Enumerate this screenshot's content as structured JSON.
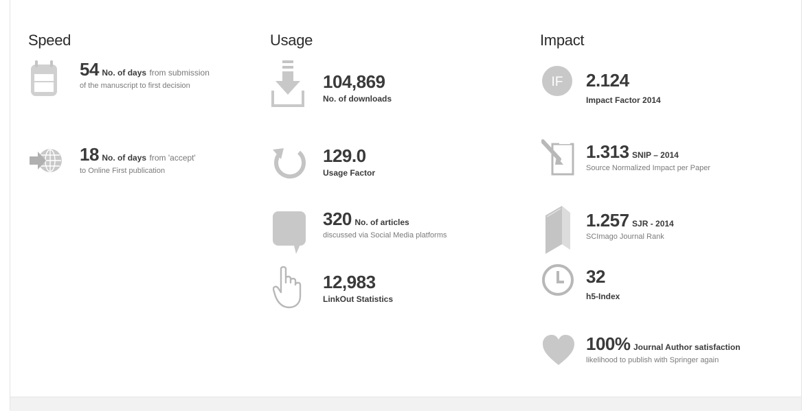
{
  "columns": {
    "speed": {
      "title": "Speed",
      "metrics": [
        {
          "icon": "calendar-icon",
          "value": "54",
          "label": "No. of days",
          "label_rest": "from submission",
          "line2": "of the manuscript to first decision"
        },
        {
          "icon": "globe-arrow-icon",
          "value": "18",
          "label": "No. of days",
          "label_rest": "from 'accept'",
          "line2": "to Online First publication"
        }
      ]
    },
    "usage": {
      "title": "Usage",
      "metrics": [
        {
          "icon": "download-icon",
          "value": "104,869",
          "line2": "No. of downloads"
        },
        {
          "icon": "refresh-icon",
          "value": "129.0",
          "line2": "Usage Factor"
        },
        {
          "icon": "speech-bubble-icon",
          "value": "320",
          "label": "No. of articles",
          "line2": "discussed via Social Media platforms"
        },
        {
          "icon": "pointer-hand-icon",
          "value": "12,983",
          "line2": "LinkOut Statistics"
        }
      ]
    },
    "impact": {
      "title": "Impact",
      "metrics": [
        {
          "icon": "impact-factor-icon",
          "icon_text": "IF",
          "value": "2.124",
          "line2": "Impact Factor 2014"
        },
        {
          "icon": "edit-document-icon",
          "value": "1.313",
          "label": "SNIP – 2014",
          "line2": "Source Normalized Impact per Paper"
        },
        {
          "icon": "book-icon",
          "value": "1.257",
          "label": "SJR - 2014",
          "line2": "SCImago Journal Rank"
        },
        {
          "icon": "clock-icon",
          "value": "32",
          "line2": "h5-Index"
        },
        {
          "icon": "heart-icon",
          "value": "100%",
          "label": "Journal Author satisfaction",
          "line2": "likelihood to publish with Springer again"
        }
      ]
    }
  },
  "colors": {
    "icon_gray": "#c8c8c8",
    "icon_dark": "#b3b3b3",
    "value_text": "#3a3a3a",
    "muted_text": "#7a7a7a"
  }
}
